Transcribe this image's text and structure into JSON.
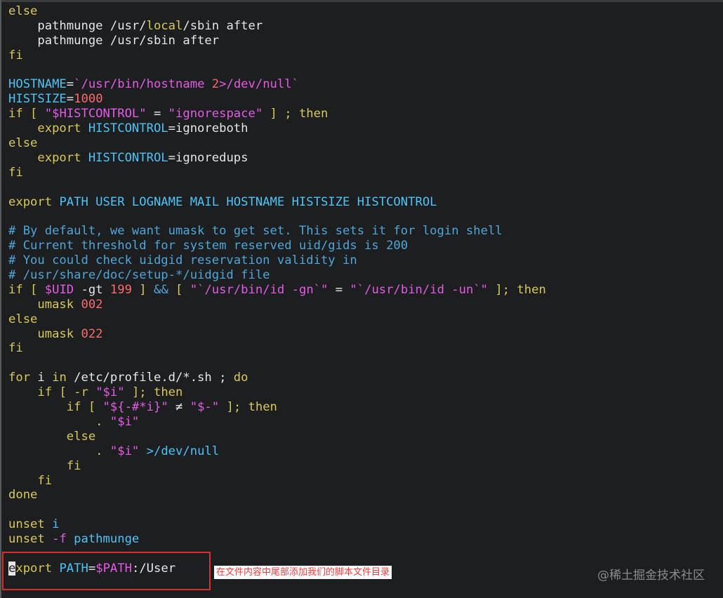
{
  "editor": {
    "lines": [
      [
        {
          "t": "else",
          "c": "kw"
        }
      ],
      [
        {
          "t": "    pathmunge /usr/",
          "c": "cmd"
        },
        {
          "t": "local",
          "c": "kw"
        },
        {
          "t": "/sbin after",
          "c": "cmd"
        }
      ],
      [
        {
          "t": "    pathmunge /usr/sbin after",
          "c": "cmd"
        }
      ],
      [
        {
          "t": "fi",
          "c": "kw"
        }
      ],
      [
        {
          "t": "",
          "c": "cmd"
        }
      ],
      [
        {
          "t": "HOSTNAME",
          "c": "var"
        },
        {
          "t": "=",
          "c": "cmd"
        },
        {
          "t": "`/usr/bin/hostname ",
          "c": "str"
        },
        {
          "t": "2",
          "c": "num"
        },
        {
          "t": ">/dev/null`",
          "c": "str"
        }
      ],
      [
        {
          "t": "HISTSIZE",
          "c": "var"
        },
        {
          "t": "=",
          "c": "cmd"
        },
        {
          "t": "1000",
          "c": "num"
        }
      ],
      [
        {
          "t": "if",
          "c": "kw"
        },
        {
          "t": " [ ",
          "c": "kw"
        },
        {
          "t": "\"$HISTCONTROL\"",
          "c": "str"
        },
        {
          "t": " = ",
          "c": "cmd"
        },
        {
          "t": "\"ignorespace\"",
          "c": "str"
        },
        {
          "t": " ] ; then",
          "c": "kw"
        }
      ],
      [
        {
          "t": "    export ",
          "c": "kw"
        },
        {
          "t": "HISTCONTROL",
          "c": "var"
        },
        {
          "t": "=ignoreboth",
          "c": "cmd"
        }
      ],
      [
        {
          "t": "else",
          "c": "kw"
        }
      ],
      [
        {
          "t": "    export ",
          "c": "kw"
        },
        {
          "t": "HISTCONTROL",
          "c": "var"
        },
        {
          "t": "=ignoredups",
          "c": "cmd"
        }
      ],
      [
        {
          "t": "fi",
          "c": "kw"
        }
      ],
      [
        {
          "t": "",
          "c": "cmd"
        }
      ],
      [
        {
          "t": "export ",
          "c": "kw"
        },
        {
          "t": "PATH USER LOGNAME MAIL HOSTNAME HISTSIZE HISTCONTROL",
          "c": "var"
        }
      ],
      [
        {
          "t": "",
          "c": "cmd"
        }
      ],
      [
        {
          "t": "# By default, we want umask to get set. This sets it for login shell",
          "c": "cmt"
        }
      ],
      [
        {
          "t": "# Current threshold for system reserved uid/gids is 200",
          "c": "cmt"
        }
      ],
      [
        {
          "t": "# You could check uidgid reservation validity in",
          "c": "cmt"
        }
      ],
      [
        {
          "t": "# /usr/share/doc/setup-*/uidgid file",
          "c": "cmt"
        }
      ],
      [
        {
          "t": "if",
          "c": "kw"
        },
        {
          "t": " [ ",
          "c": "kw"
        },
        {
          "t": "$UID",
          "c": "str"
        },
        {
          "t": " -gt ",
          "c": "cmd"
        },
        {
          "t": "199",
          "c": "num"
        },
        {
          "t": " ] ",
          "c": "kw"
        },
        {
          "t": "&&",
          "c": "cmt"
        },
        {
          "t": " [ ",
          "c": "kw"
        },
        {
          "t": "\"`/usr/bin/id -gn`\"",
          "c": "str"
        },
        {
          "t": " = ",
          "c": "cmd"
        },
        {
          "t": "\"`/usr/bin/id -un`\"",
          "c": "str"
        },
        {
          "t": " ]; then",
          "c": "kw"
        }
      ],
      [
        {
          "t": "    umask ",
          "c": "kw"
        },
        {
          "t": "002",
          "c": "num"
        }
      ],
      [
        {
          "t": "else",
          "c": "kw"
        }
      ],
      [
        {
          "t": "    umask ",
          "c": "kw"
        },
        {
          "t": "022",
          "c": "num"
        }
      ],
      [
        {
          "t": "fi",
          "c": "kw"
        }
      ],
      [
        {
          "t": "",
          "c": "cmd"
        }
      ],
      [
        {
          "t": "for",
          "c": "kw"
        },
        {
          "t": " i ",
          "c": "cmd"
        },
        {
          "t": "in",
          "c": "kw"
        },
        {
          "t": " /etc/profile.d/*.sh ; ",
          "c": "cmd"
        },
        {
          "t": "do",
          "c": "kw"
        }
      ],
      [
        {
          "t": "    if",
          "c": "kw"
        },
        {
          "t": " [ -r ",
          "c": "kw"
        },
        {
          "t": "\"$i\"",
          "c": "str"
        },
        {
          "t": " ]; then",
          "c": "kw"
        }
      ],
      [
        {
          "t": "        if",
          "c": "kw"
        },
        {
          "t": " [ ",
          "c": "kw"
        },
        {
          "t": "\"${-#*i}\"",
          "c": "str"
        },
        {
          "t": " ≠ ",
          "c": "cmd"
        },
        {
          "t": "\"$-\"",
          "c": "str"
        },
        {
          "t": " ]; then",
          "c": "kw"
        }
      ],
      [
        {
          "t": "            . ",
          "c": "kw"
        },
        {
          "t": "\"$i\"",
          "c": "str"
        }
      ],
      [
        {
          "t": "        else",
          "c": "kw"
        }
      ],
      [
        {
          "t": "            . ",
          "c": "kw"
        },
        {
          "t": "\"$i\"",
          "c": "str"
        },
        {
          "t": " >/dev/null",
          "c": "var"
        }
      ],
      [
        {
          "t": "        fi",
          "c": "kw"
        }
      ],
      [
        {
          "t": "    fi",
          "c": "kw"
        }
      ],
      [
        {
          "t": "done",
          "c": "kw"
        }
      ],
      [
        {
          "t": "",
          "c": "cmd"
        }
      ],
      [
        {
          "t": "unset ",
          "c": "kw"
        },
        {
          "t": "i",
          "c": "var"
        }
      ],
      [
        {
          "t": "unset ",
          "c": "kw"
        },
        {
          "t": "-f ",
          "c": "str"
        },
        {
          "t": "pathmunge",
          "c": "var"
        }
      ],
      [
        {
          "t": "",
          "c": "cmd"
        }
      ],
      [
        {
          "t": "e",
          "c": "cursor"
        },
        {
          "t": "xport ",
          "c": "kw"
        },
        {
          "t": "PATH",
          "c": "var"
        },
        {
          "t": "=",
          "c": "cmd"
        },
        {
          "t": "$PATH",
          "c": "str"
        },
        {
          "t": ":/User",
          "c": "cmd"
        }
      ]
    ]
  },
  "annotation": {
    "text": "在文件内容中尾部添加我们的脚本文件目录"
  },
  "watermark": {
    "text": "@稀土掘金技术社区"
  },
  "colors": {
    "keyword": "#d9c85a",
    "variable": "#4fc3f7",
    "string": "#e45be6",
    "comment": "#4fa6d9",
    "number": "#ff6b6b",
    "highlight": "#e02b2b"
  }
}
